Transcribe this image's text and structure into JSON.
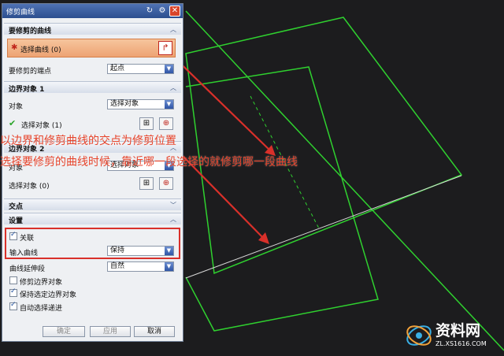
{
  "dialog": {
    "title": "修剪曲线",
    "colors": {
      "title_bg": "#2c4e8e",
      "highlight": "#f0b07a",
      "accent_red": "#d9302a"
    }
  },
  "section_curve": {
    "header": "要修剪的曲线",
    "select_label": "选择曲线 (0)",
    "endpoint_label": "要修剪的端点",
    "endpoint_value": "起点"
  },
  "section_boundary1": {
    "header": "边界对象 1",
    "object_label": "对象",
    "object_value": "选择对象",
    "select_label": "选择对象 (1)"
  },
  "section_boundary2": {
    "header": "边界对象 2",
    "object_label": "对象",
    "object_value": "选择对象",
    "select_label": "选择对象 (0)"
  },
  "section_intersection": {
    "header": "交点"
  },
  "section_settings": {
    "header": "设置",
    "associative_label": "关联",
    "input_curve_label": "输入曲线",
    "input_curve_value": "保持",
    "extension_label": "曲线延伸段",
    "extension_value": "自然",
    "trim_boundary_label": "修剪边界对象",
    "keep_selected_label": "保持选定边界对象",
    "auto_advance_label": "自动选择递进",
    "checks": {
      "associative": true,
      "trim_boundary": false,
      "keep_selected": true,
      "auto_advance": true
    }
  },
  "buttons": {
    "ok": "确定",
    "apply": "应用",
    "cancel": "取消"
  },
  "annotations": {
    "line1": "以边界和修剪曲线的交点为修剪位置",
    "line2": "选择要修剪的曲线时候，靠近哪一段选择的就修剪哪一段曲线"
  },
  "watermark": {
    "brand": "资料网",
    "url": "ZL.XS1616.COM"
  },
  "icons": {
    "rotate": "rotate-icon",
    "gear": "gear-icon",
    "close": "close-icon",
    "curve_select": "curve-select-icon",
    "point_constructor": "point-constructor-icon",
    "crosshair": "crosshair-icon",
    "checkmark": "checkmark-icon",
    "asterisk": "required-asterisk-icon"
  }
}
